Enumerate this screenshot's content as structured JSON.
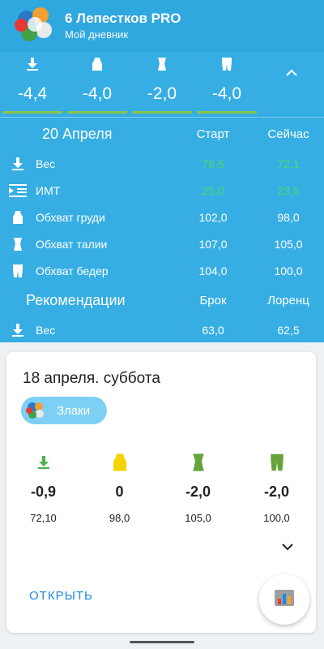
{
  "app": {
    "title": "6 Лепестков PRO",
    "subtitle": "Мой дневник"
  },
  "summary": {
    "items": [
      {
        "icon": "weight-down-icon",
        "value": "-4,4"
      },
      {
        "icon": "chest-icon",
        "value": "-4,0"
      },
      {
        "icon": "waist-icon",
        "value": "-2,0"
      },
      {
        "icon": "hips-icon",
        "value": "-4,0"
      }
    ],
    "collapse_icon": "chevron-up-icon"
  },
  "table": {
    "date": "20 Апреля",
    "col_start": "Старт",
    "col_now": "Сейчас",
    "rows": [
      {
        "icon": "weight-down-icon",
        "name": "Вес",
        "start": "76,5",
        "now": "72,1",
        "highlight": true
      },
      {
        "icon": "bmi-icon",
        "name": "ИМТ",
        "start": "25,0",
        "now": "23,5",
        "highlight": true
      },
      {
        "icon": "chest-icon",
        "name": "Обхват груди",
        "start": "102,0",
        "now": "98,0",
        "highlight": false
      },
      {
        "icon": "waist-icon",
        "name": "Обхват талии",
        "start": "107,0",
        "now": "105,0",
        "highlight": false
      },
      {
        "icon": "hips-icon",
        "name": "Обхват бедер",
        "start": "104,0",
        "now": "100,0",
        "highlight": false
      }
    ],
    "recommendations": {
      "title": "Рекомендации",
      "col_1": "Брок",
      "col_2": "Лоренц",
      "rows": [
        {
          "icon": "weight-down-icon",
          "name": "Вес",
          "v1": "63,0",
          "v2": "62,5"
        }
      ]
    }
  },
  "card": {
    "title": "18 апреля. суббота",
    "chip_label": "Злаки",
    "stats": [
      {
        "icon": "weight-down-icon",
        "color": "#4caf50",
        "delta": "-0,9",
        "abs": "72,10"
      },
      {
        "icon": "chest-icon",
        "color": "#f5d300",
        "delta": "0",
        "abs": "98,0"
      },
      {
        "icon": "waist-icon",
        "color": "#66a33a",
        "delta": "-2,0",
        "abs": "105,0"
      },
      {
        "icon": "hips-icon",
        "color": "#66a33a",
        "delta": "-2,0",
        "abs": "100,0"
      }
    ],
    "open_label": "ОТКРЫТЬ",
    "expand_icon": "chevron-down-icon"
  },
  "fab": {
    "icon": "chart-icon"
  },
  "colors": {
    "primary": "#2fa7df",
    "panel": "#36aee4",
    "accent_green": "#4dd86a",
    "link": "#1e88e5"
  }
}
